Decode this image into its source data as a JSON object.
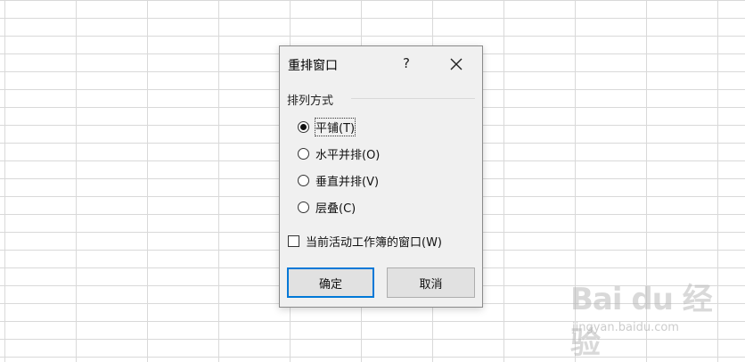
{
  "dialog": {
    "title": "重排窗口",
    "help_label": "?",
    "close_icon": "close-icon",
    "group_label": "排列方式",
    "options": [
      {
        "label": "平铺(T)",
        "checked": true
      },
      {
        "label": "水平并排(O)",
        "checked": false
      },
      {
        "label": "垂直并排(V)",
        "checked": false
      },
      {
        "label": "层叠(C)",
        "checked": false
      }
    ],
    "checkbox": {
      "label": "当前活动工作簿的窗口(W)",
      "checked": false
    },
    "ok_label": "确定",
    "cancel_label": "取消",
    "accent_color": "#0078d7"
  },
  "watermark": {
    "logo_text": "Bai du 经验",
    "url_text": "jingyan.baidu.com"
  }
}
